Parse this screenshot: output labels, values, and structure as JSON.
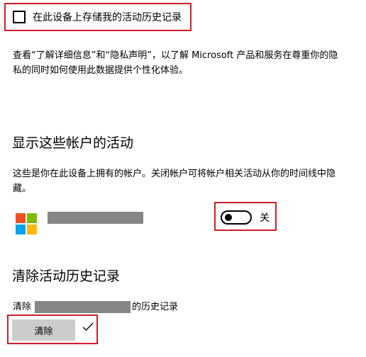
{
  "activity_history": {
    "store_checkbox_label": "在此设备上存储我的活动历史记录",
    "store_checkbox_checked": false,
    "privacy_text": "查看“了解详细信息”和“隐私声明”，以了解 Microsoft 产品和服务在尊重你的隐私的同时如何使用此数据提供个性化体验。"
  },
  "accounts_section": {
    "heading": "显示这些帐户的活动",
    "description": "这些是你在此设备上拥有的帐户。关闭帐户可将帐户相关活动从你的时间线中隐藏。",
    "account": {
      "logo_icon": "microsoft-logo-icon",
      "name_redacted": true,
      "toggle_on": false,
      "toggle_label": "关"
    }
  },
  "clear_section": {
    "heading": "清除活动历史记录",
    "text_prefix": "清除",
    "text_suffix": "的历史记录",
    "clear_button_label": "清除",
    "status_icon": "checkmark-icon"
  },
  "colors": {
    "highlight": "#d11d2a",
    "ms_red": "#f25022",
    "ms_green": "#7fba00",
    "ms_blue": "#00a4ef",
    "ms_yellow": "#ffb900",
    "redaction": "#868686",
    "button_bg": "#cccccc"
  }
}
